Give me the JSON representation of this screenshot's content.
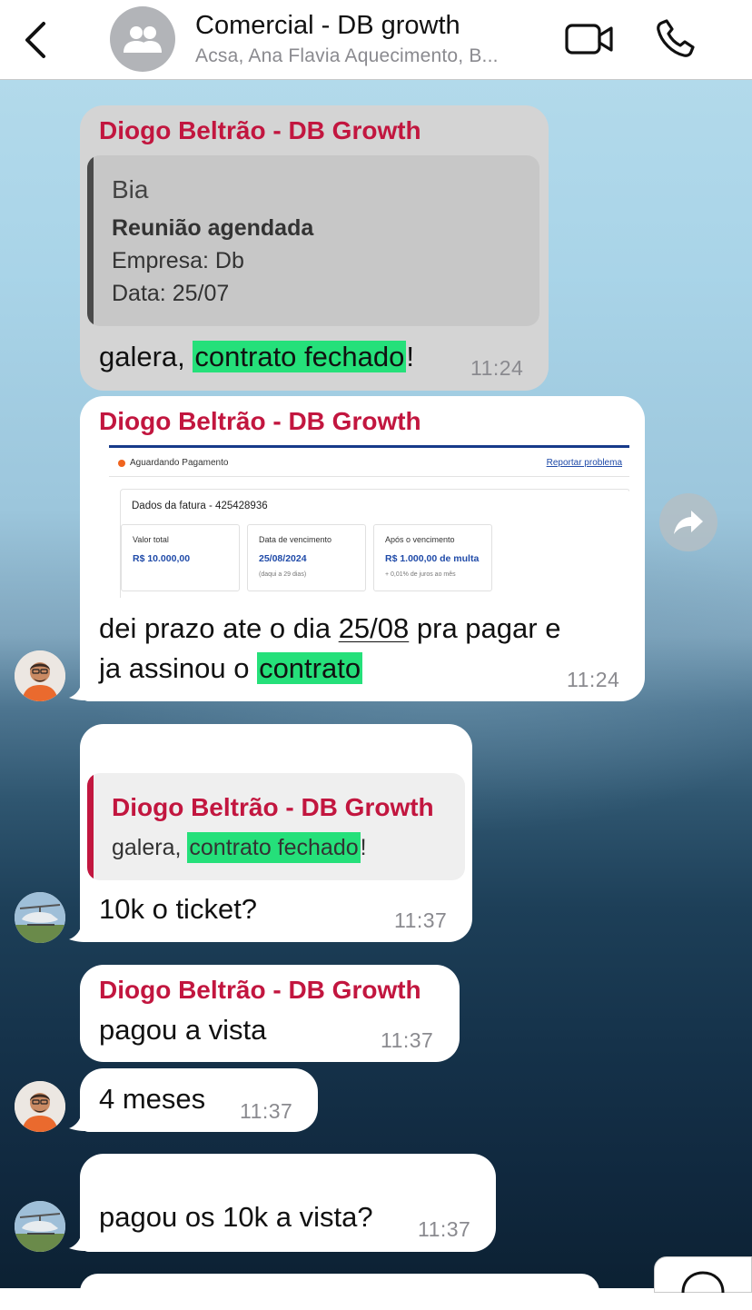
{
  "header": {
    "back_icon": "chevron-left-icon",
    "group_icon": "group-people-icon",
    "title": "Comercial - DB growth",
    "subtitle": "Acsa, Ana Flavia Aquecimento, B...",
    "video_icon": "video-camera-icon",
    "phone_icon": "phone-icon"
  },
  "messages": [
    {
      "sender": "Diogo Beltrão - DB Growth",
      "quote": {
        "author": "Bia",
        "title": "Reunião agendada",
        "line1": "Empresa: Db",
        "line2": "Data: 25/07"
      },
      "text_before": "galera, ",
      "text_highlight": "contrato fechado",
      "text_after": "!",
      "time": "11:24"
    },
    {
      "sender": "Diogo Beltrão - DB Growth",
      "invoice": {
        "status": "Aguardando Pagamento",
        "report_link": "Reportar problema",
        "heading": "Dados da fatura - 425428936",
        "boxes": [
          {
            "label": "Valor total",
            "value": "R$ 10.000,00",
            "note": ""
          },
          {
            "label": "Data de vencimento",
            "value": "25/08/2024",
            "note": "(daqui a 29 dias)"
          },
          {
            "label": "Após o vencimento",
            "value": "R$ 1.000,00 de multa",
            "note": "+ 0,01% de juros ao mês"
          }
        ]
      },
      "line1_before": "dei prazo ate o dia ",
      "line1_date": "25/08",
      "line1_after": " pra pagar e",
      "line2_before": "ja assinou o ",
      "line2_highlight": "contrato",
      "time": "11:24"
    },
    {
      "quote": {
        "author": "Diogo Beltrão - DB Growth",
        "text_before": "galera, ",
        "text_highlight": "contrato fechado",
        "text_after": "!"
      },
      "text": "10k o ticket?",
      "time": "11:37"
    },
    {
      "sender": "Diogo Beltrão - DB Growth",
      "text": "pagou a vista",
      "time": "11:37"
    },
    {
      "text": "4 meses",
      "time": "11:37"
    },
    {
      "text": "pagou os 10k a vista?",
      "time": "11:37"
    }
  ],
  "forward_icon": "forward-arrow-icon",
  "colors": {
    "sender": "#c2163f",
    "highlight": "#25e07a",
    "quote_bar_dark": "#4a4a4a",
    "quote_bar_red": "#c2163f",
    "timestamp": "#8a8a8f"
  }
}
